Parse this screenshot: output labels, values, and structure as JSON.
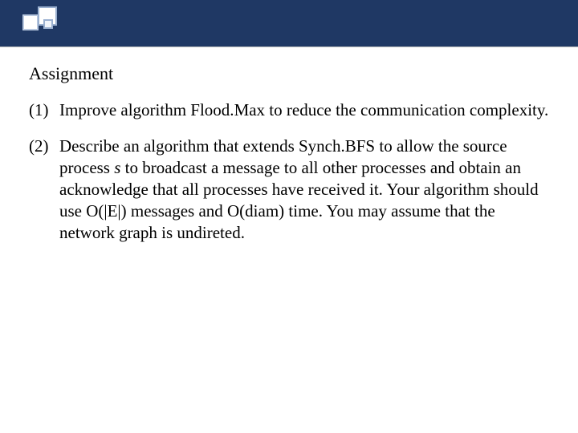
{
  "title": "Assignment",
  "items": [
    {
      "num": "(1)",
      "before": "Improve algorithm Flood.",
      "alg": "",
      "after": "Max  to reduce the communication complexity."
    },
    {
      "num": "(2)",
      "before": "Describe an algorithm that extends Synch.",
      "alg": "",
      "after_part1": "BFS to allow the source process ",
      "s": "s",
      "after_part2": " to broadcast a message to all other processes and obtain an acknowledge that all processes have received it. Your algorithm should use O(|E|) messages and O(diam) time. You may assume that the network graph is undireted."
    }
  ]
}
